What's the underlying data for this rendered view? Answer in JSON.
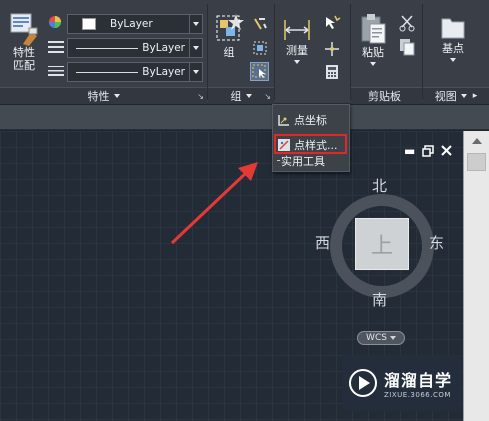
{
  "ribbon": {
    "properties_panel": {
      "match_button_label_line1": "特性",
      "match_button_label_line2": "匹配",
      "color_dropdown": "ByLayer",
      "linetype_dropdown": "ByLayer",
      "lineweight_dropdown": "ByLayer",
      "panel_label": "特性"
    },
    "groups_panel": {
      "group_button_label": "组",
      "panel_label": "组"
    },
    "utilities_panel": {
      "measure_button_label": "测量"
    },
    "clipboard_panel": {
      "paste_button_label": "粘贴",
      "panel_label": "剪贴板"
    },
    "view_panel": {
      "base_button_label": "基点",
      "panel_label": "视图"
    }
  },
  "popup_menu": {
    "items": [
      {
        "label": "点坐标",
        "icon": "point-coordinate-icon"
      },
      {
        "label": "点样式...",
        "icon": "point-style-icon"
      }
    ],
    "footer_label": "实用工具"
  },
  "viewcube": {
    "north": "北",
    "south": "南",
    "east": "东",
    "west": "西",
    "face": "上",
    "wcs_label": "WCS"
  },
  "watermark": {
    "brand_cn": "溜溜自学",
    "brand_url": "ZIXUE.3066.COM"
  },
  "colors": {
    "ribbon_bg": "#3a3f47",
    "canvas_bg": "#222b36",
    "highlight_border": "#e02828",
    "annotation_arrow": "#e53935"
  }
}
